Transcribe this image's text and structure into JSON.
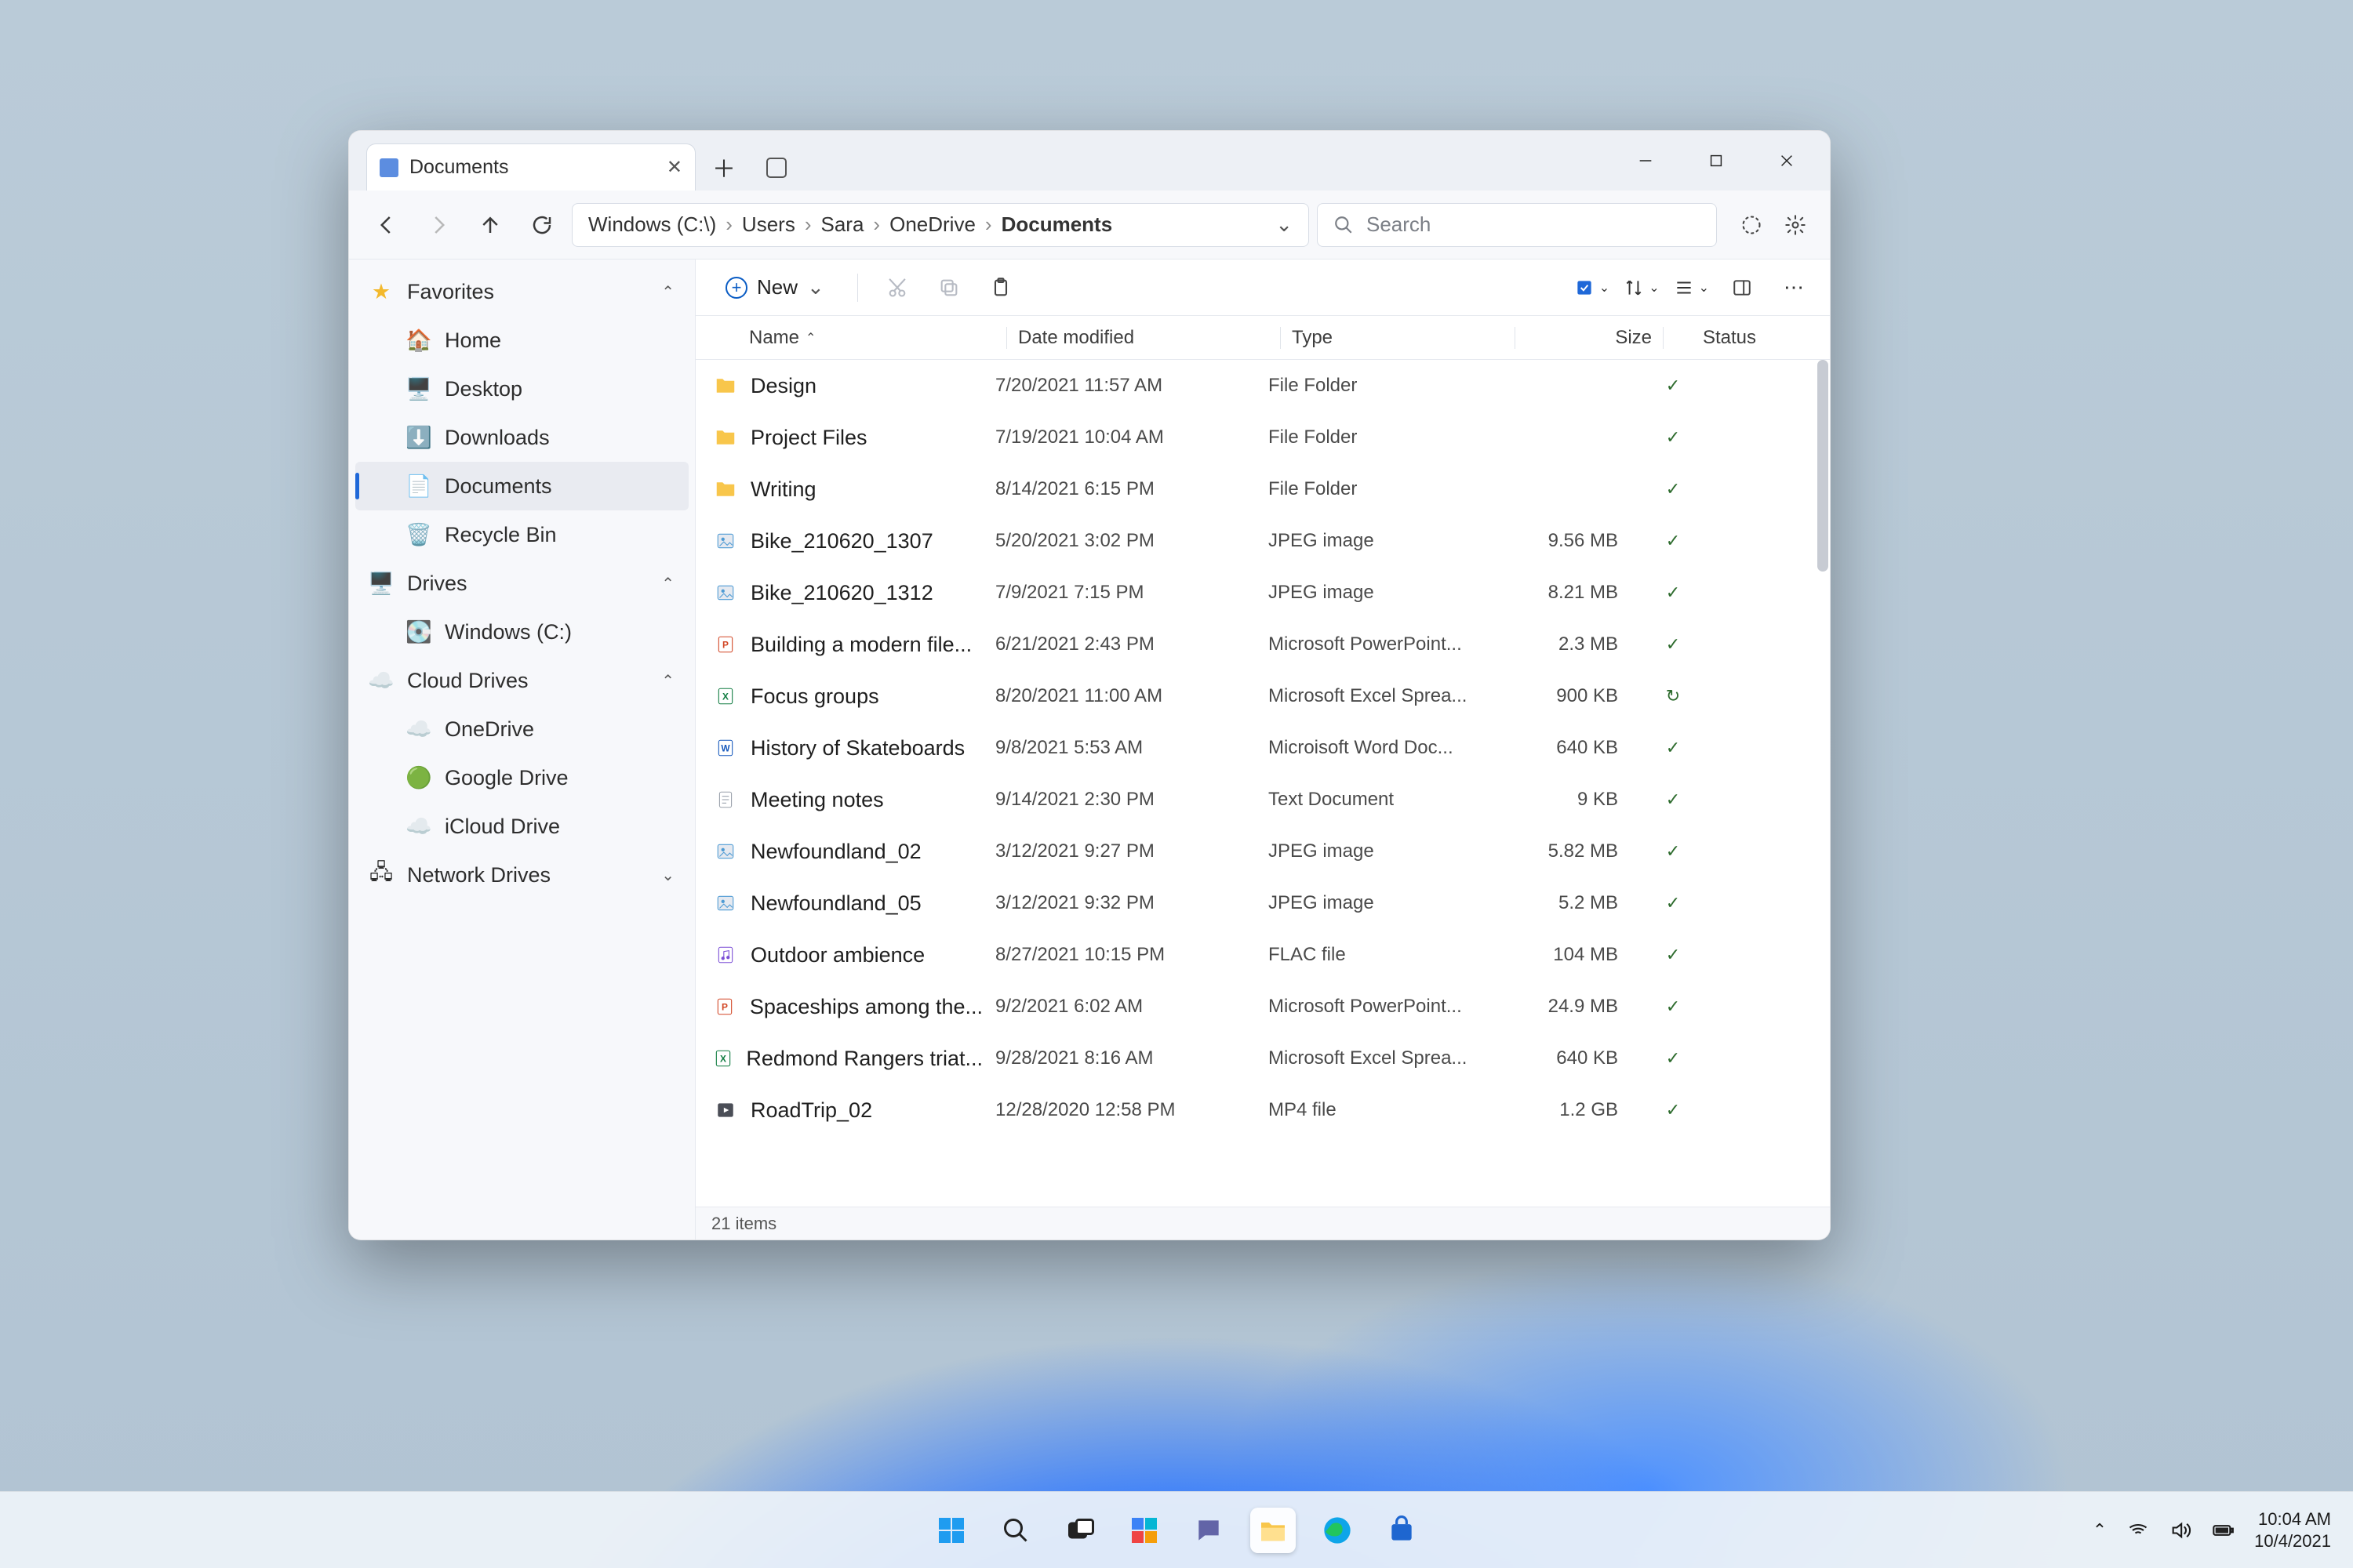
{
  "window": {
    "tab_title": "Documents",
    "breadcrumb": [
      "Windows (C:\\)",
      "Users",
      "Sara",
      "OneDrive",
      "Documents"
    ],
    "search_placeholder": "Search"
  },
  "toolbar": {
    "new_label": "New"
  },
  "sidebar": {
    "favorites": {
      "label": "Favorites",
      "items": [
        {
          "label": "Home",
          "icon": "home"
        },
        {
          "label": "Desktop",
          "icon": "desktop"
        },
        {
          "label": "Downloads",
          "icon": "downloads"
        },
        {
          "label": "Documents",
          "icon": "documents",
          "active": true
        },
        {
          "label": "Recycle Bin",
          "icon": "recycle"
        }
      ]
    },
    "drives": {
      "label": "Drives",
      "items": [
        {
          "label": "Windows (C:)",
          "icon": "drive"
        }
      ]
    },
    "cloud": {
      "label": "Cloud Drives",
      "items": [
        {
          "label": "OneDrive",
          "icon": "onedrive"
        },
        {
          "label": "Google Drive",
          "icon": "gdrive"
        },
        {
          "label": "iCloud Drive",
          "icon": "icloud"
        }
      ]
    },
    "network": {
      "label": "Network Drives"
    }
  },
  "columns": {
    "name": "Name",
    "date": "Date modified",
    "type": "Type",
    "size": "Size",
    "status": "Status"
  },
  "files": [
    {
      "name": "Design",
      "date": "7/20/2021  11:57 AM",
      "type": "File Folder",
      "size": "",
      "icon": "folder",
      "status": "ok"
    },
    {
      "name": "Project Files",
      "date": "7/19/2021  10:04 AM",
      "type": "File Folder",
      "size": "",
      "icon": "folder",
      "status": "ok"
    },
    {
      "name": "Writing",
      "date": "8/14/2021  6:15 PM",
      "type": "File Folder",
      "size": "",
      "icon": "folder",
      "status": "ok"
    },
    {
      "name": "Bike_210620_1307",
      "date": "5/20/2021  3:02 PM",
      "type": "JPEG image",
      "size": "9.56 MB",
      "icon": "image",
      "status": "ok"
    },
    {
      "name": "Bike_210620_1312",
      "date": "7/9/2021  7:15 PM",
      "type": "JPEG image",
      "size": "8.21 MB",
      "icon": "image",
      "status": "ok"
    },
    {
      "name": "Building a modern file...",
      "date": "6/21/2021  2:43 PM",
      "type": "Microsoft PowerPoint...",
      "size": "2.3 MB",
      "icon": "ppt",
      "status": "ok"
    },
    {
      "name": "Focus groups",
      "date": "8/20/2021  11:00 AM",
      "type": "Microsoft Excel Sprea...",
      "size": "900 KB",
      "icon": "xls",
      "status": "sync"
    },
    {
      "name": "History of Skateboards",
      "date": "9/8/2021  5:53 AM",
      "type": "Microisoft Word Doc...",
      "size": "640 KB",
      "icon": "doc",
      "status": "ok"
    },
    {
      "name": "Meeting notes",
      "date": "9/14/2021  2:30 PM",
      "type": "Text Document",
      "size": "9 KB",
      "icon": "txt",
      "status": "ok"
    },
    {
      "name": "Newfoundland_02",
      "date": "3/12/2021  9:27 PM",
      "type": "JPEG image",
      "size": "5.82 MB",
      "icon": "image",
      "status": "ok"
    },
    {
      "name": "Newfoundland_05",
      "date": "3/12/2021  9:32 PM",
      "type": "JPEG image",
      "size": "5.2 MB",
      "icon": "image",
      "status": "ok"
    },
    {
      "name": "Outdoor ambience",
      "date": "8/27/2021  10:15 PM",
      "type": "FLAC file",
      "size": "104 MB",
      "icon": "audio",
      "status": "ok"
    },
    {
      "name": "Spaceships among the...",
      "date": "9/2/2021  6:02 AM",
      "type": "Microsoft PowerPoint...",
      "size": "24.9 MB",
      "icon": "ppt",
      "status": "ok"
    },
    {
      "name": "Redmond Rangers triat...",
      "date": "9/28/2021  8:16 AM",
      "type": "Microsoft Excel Sprea...",
      "size": "640 KB",
      "icon": "xls",
      "status": "ok"
    },
    {
      "name": "RoadTrip_02",
      "date": "12/28/2020  12:58 PM",
      "type": "MP4 file",
      "size": "1.2 GB",
      "icon": "video",
      "status": "ok"
    }
  ],
  "statusbar": "21 items",
  "tray": {
    "time": "10:04 AM",
    "date": "10/4/2021"
  }
}
